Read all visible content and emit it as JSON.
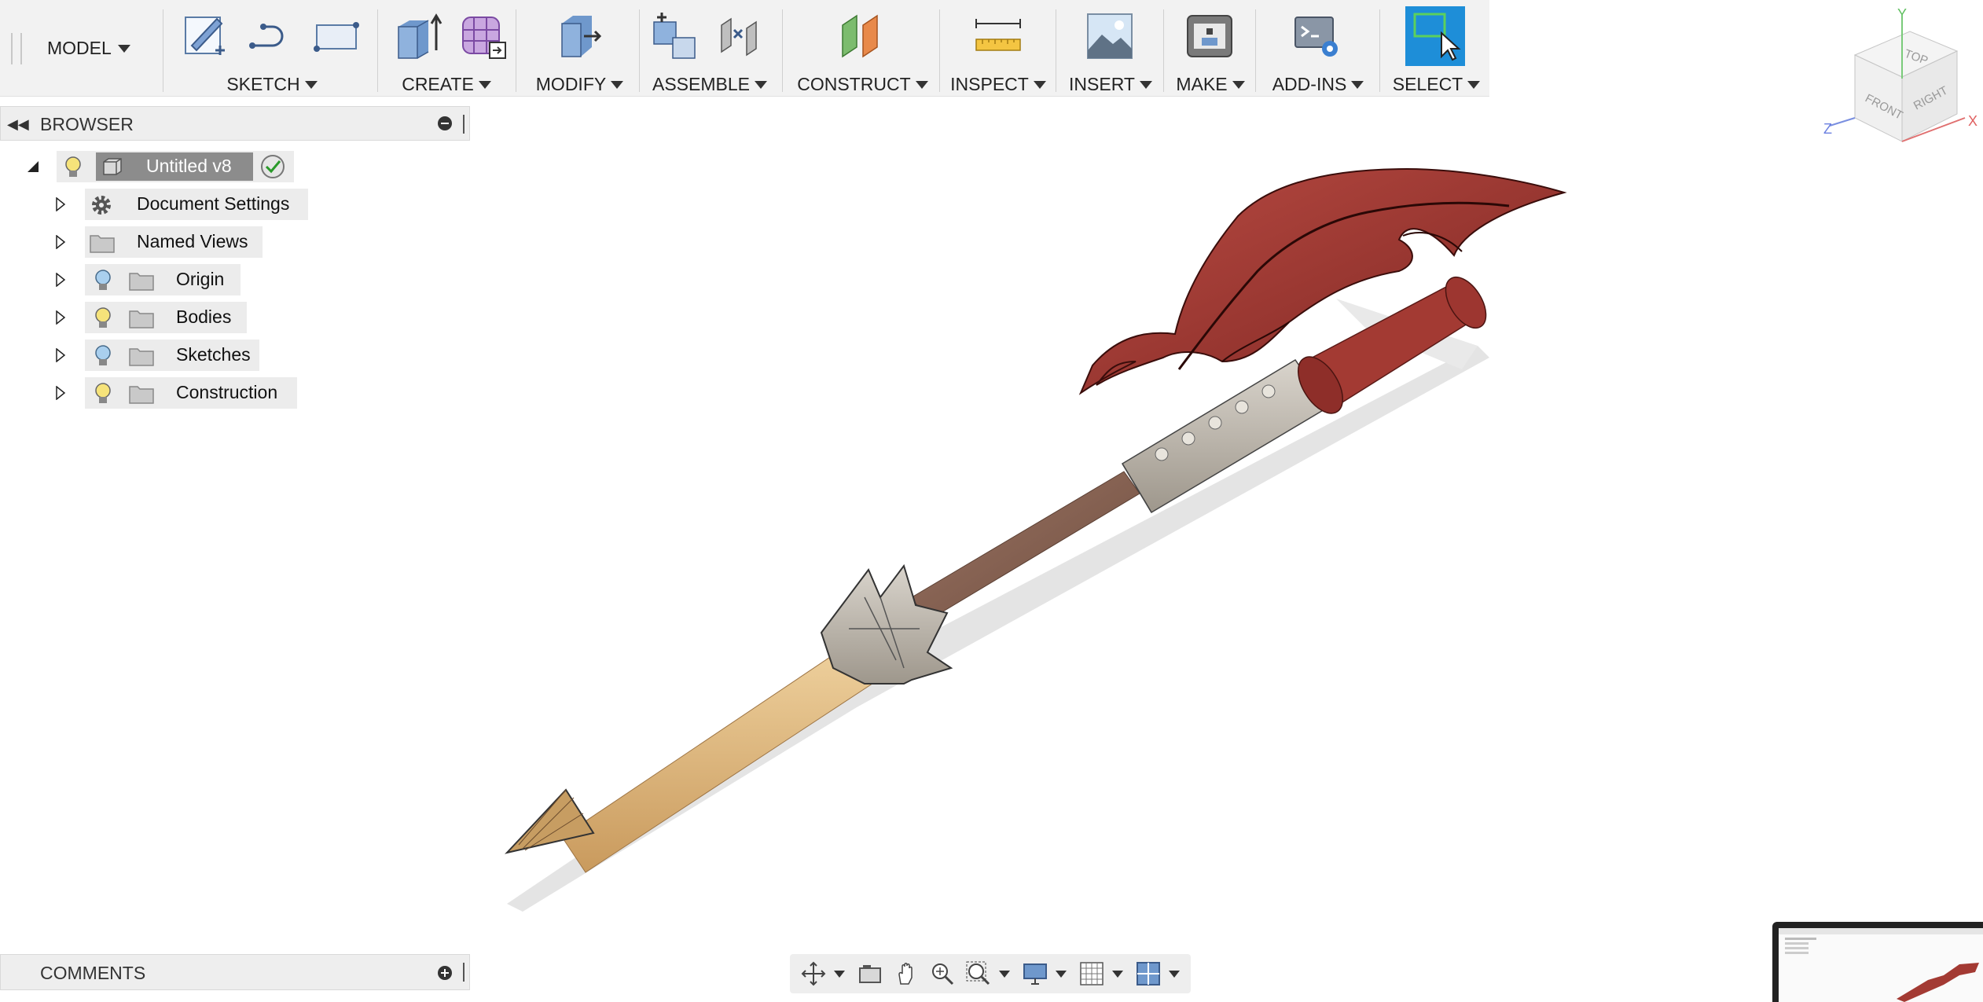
{
  "toolbar": {
    "workspace": "MODEL",
    "groups": [
      {
        "label": "SKETCH"
      },
      {
        "label": "CREATE"
      },
      {
        "label": "MODIFY"
      },
      {
        "label": "ASSEMBLE"
      },
      {
        "label": "CONSTRUCT"
      },
      {
        "label": "INSPECT"
      },
      {
        "label": "INSERT"
      },
      {
        "label": "MAKE"
      },
      {
        "label": "ADD-INS"
      },
      {
        "label": "SELECT"
      }
    ]
  },
  "browser": {
    "title": "BROWSER",
    "root": "Untitled v8",
    "items": [
      {
        "label": "Document Settings"
      },
      {
        "label": "Named Views"
      },
      {
        "label": "Origin"
      },
      {
        "label": "Bodies"
      },
      {
        "label": "Sketches"
      },
      {
        "label": "Construction"
      }
    ]
  },
  "comments": {
    "title": "COMMENTS"
  },
  "viewcube": {
    "top": "TOP",
    "front": "FRONT",
    "right": "RIGHT",
    "x": "X",
    "y": "Y",
    "z": "Z"
  },
  "colors": {
    "toolbar_bg": "#f2f2f2",
    "select_active": "#1e8ed8",
    "blade": "#9e3b34",
    "handle_wood": "#8a6450",
    "grip_wood": "#d9b07c",
    "metal": "#b8b2a8"
  }
}
